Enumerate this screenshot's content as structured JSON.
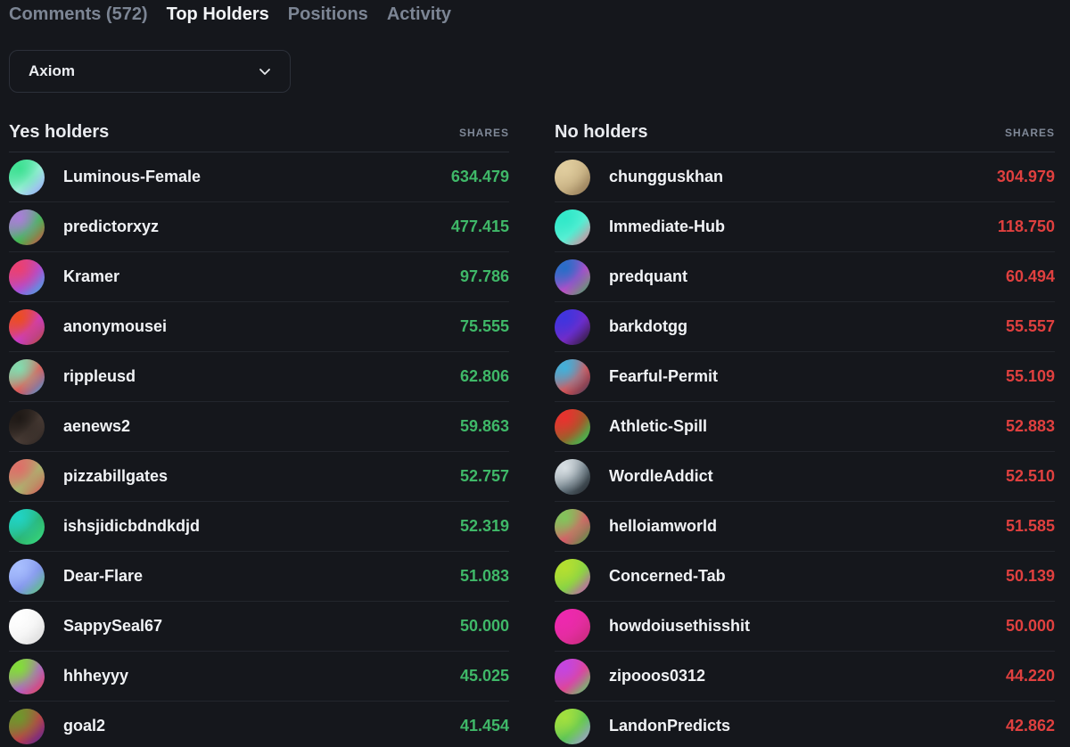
{
  "tabs": [
    {
      "label": "Comments (572)",
      "active": false
    },
    {
      "label": "Top Holders",
      "active": true
    },
    {
      "label": "Positions",
      "active": false
    },
    {
      "label": "Activity",
      "active": false
    }
  ],
  "filter": {
    "selected": "Axiom"
  },
  "yes": {
    "title": "Yes holders",
    "shares_label": "SHARES",
    "rows": [
      {
        "name": "Luminous-Female",
        "shares": "634.479",
        "avatar": [
          "#38e08e",
          "#a7f0e0",
          "#8fa0f5"
        ]
      },
      {
        "name": "predictorxyz",
        "shares": "477.415",
        "avatar": [
          "#b07ae0",
          "#36c24a",
          "#e2424d"
        ]
      },
      {
        "name": "Kramer",
        "shares": "97.786",
        "avatar": [
          "#ef3f6a",
          "#a84fe0",
          "#3fb0d8"
        ]
      },
      {
        "name": "anonymousei",
        "shares": "75.555",
        "avatar": [
          "#ee4e18",
          "#c63ad8",
          "#b84d24"
        ]
      },
      {
        "name": "rippleusd",
        "shares": "62.806",
        "avatar": [
          "#7ce4b4",
          "#e94f4f",
          "#36a1e4"
        ]
      },
      {
        "name": "aenews2",
        "shares": "59.863",
        "avatar": [
          "#1c1714",
          "#4d3f38",
          "#2a2320"
        ]
      },
      {
        "name": "pizzabillgates",
        "shares": "52.757",
        "avatar": [
          "#e16b68",
          "#a0c070",
          "#e24a56"
        ]
      },
      {
        "name": "ishsjidicbdndkdjd",
        "shares": "52.319",
        "avatar": [
          "#20d4c8",
          "#2fb066",
          "#36e28c"
        ]
      },
      {
        "name": "Dear-Flare",
        "shares": "51.083",
        "avatar": [
          "#a9c0ff",
          "#7c8ee8",
          "#5fd076"
        ]
      },
      {
        "name": "SappySeal67",
        "shares": "50.000",
        "avatar": [
          "#ffffff",
          "#f2f2f2",
          "#d9d9d9"
        ]
      },
      {
        "name": "hhheyyy",
        "shares": "45.025",
        "avatar": [
          "#7fe62e",
          "#b25bd4",
          "#e24a46"
        ]
      },
      {
        "name": "goal2",
        "shares": "41.454",
        "avatar": [
          "#6a9c2a",
          "#c23a4a",
          "#4e2a9a"
        ]
      }
    ]
  },
  "no": {
    "title": "No holders",
    "shares_label": "SHARES",
    "rows": [
      {
        "name": "chungguskhan",
        "shares": "304.979",
        "avatar": [
          "#e2cfa0",
          "#c2ab7e",
          "#8d7452"
        ]
      },
      {
        "name": "Immediate-Hub",
        "shares": "118.750",
        "avatar": [
          "#2ee8c8",
          "#62f0d6",
          "#e07890"
        ]
      },
      {
        "name": "predquant",
        "shares": "60.494",
        "avatar": [
          "#1e70c8",
          "#c84ac8",
          "#38b05a"
        ]
      },
      {
        "name": "barkdotgg",
        "shares": "55.557",
        "avatar": [
          "#3c35e0",
          "#7c2ac4",
          "#1d1d2a"
        ]
      },
      {
        "name": "Fearful-Permit",
        "shares": "55.109",
        "avatar": [
          "#38b6e2",
          "#e25050",
          "#3c3c5c"
        ]
      },
      {
        "name": "Athletic-Spill",
        "shares": "52.883",
        "avatar": [
          "#ee2f2f",
          "#8a6a2a",
          "#2fd460"
        ]
      },
      {
        "name": "WordleAddict",
        "shares": "52.510",
        "avatar": [
          "#dfe6ea",
          "#5a6a74",
          "#202428"
        ]
      },
      {
        "name": "helloiamworld",
        "shares": "51.585",
        "avatar": [
          "#7ccc5a",
          "#e2506a",
          "#3aa840"
        ]
      },
      {
        "name": "Concerned-Tab",
        "shares": "50.139",
        "avatar": [
          "#b8e02e",
          "#7ed04a",
          "#d64abf"
        ]
      },
      {
        "name": "howdoiusethisshit",
        "shares": "50.000",
        "avatar": [
          "#ee28b0",
          "#e02e9a",
          "#c82a7c"
        ]
      },
      {
        "name": "zipooos0312",
        "shares": "44.220",
        "avatar": [
          "#c245e6",
          "#e2468a",
          "#4ce070"
        ]
      },
      {
        "name": "LandonPredicts",
        "shares": "42.862",
        "avatar": [
          "#a8e23c",
          "#52c05a",
          "#b8a0e0"
        ]
      }
    ]
  }
}
